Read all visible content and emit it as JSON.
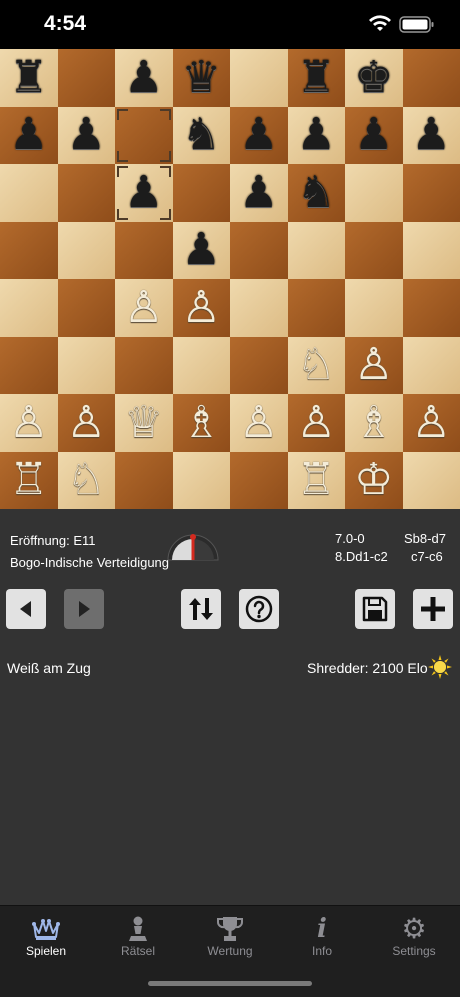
{
  "status_bar": {
    "time": "4:54"
  },
  "board": {
    "rows": [
      [
        "♜",
        "",
        "♟",
        "♛",
        "",
        "♜",
        "♚",
        ""
      ],
      [
        "♟",
        "♟",
        "",
        "♞",
        "♟",
        "♟",
        "♟",
        "♟"
      ],
      [
        "",
        "",
        "♟",
        "",
        "♟",
        "♞",
        "",
        ""
      ],
      [
        "",
        "",
        "",
        "♟",
        "",
        "",
        "",
        ""
      ],
      [
        "",
        "",
        "♙",
        "♙",
        "",
        "",
        "",
        ""
      ],
      [
        "",
        "",
        "",
        "",
        "",
        "♘",
        "♙",
        ""
      ],
      [
        "♙",
        "♙",
        "♕",
        "♗",
        "♙",
        "♙",
        "♗",
        "♙"
      ],
      [
        "♖",
        "♘",
        "",
        "",
        "",
        "♖",
        "♔",
        ""
      ]
    ],
    "colors": [
      [
        "b",
        "",
        "b",
        "b",
        "",
        "b",
        "b",
        ""
      ],
      [
        "b",
        "b",
        "",
        "b",
        "b",
        "b",
        "b",
        "b"
      ],
      [
        "",
        "",
        "b",
        "",
        "b",
        "b",
        "",
        ""
      ],
      [
        "",
        "",
        "",
        "b",
        "",
        "",
        "",
        ""
      ],
      [
        "",
        "",
        "w",
        "w",
        "",
        "",
        "",
        ""
      ],
      [
        "",
        "",
        "",
        "",
        "",
        "w",
        "w",
        ""
      ],
      [
        "w",
        "w",
        "w",
        "w",
        "w",
        "w",
        "w",
        "w"
      ],
      [
        "w",
        "w",
        "",
        "",
        "",
        "w",
        "w",
        ""
      ]
    ],
    "light_color": "#e6c998",
    "dark_color": "#a25b24"
  },
  "game_info": {
    "opening_label": "Eröffnung: E11",
    "opening_name": "Bogo-Indische Verteidigung",
    "moves": [
      {
        "col1": "7.0-0",
        "col2": "Sb8-d7"
      },
      {
        "col1": "8.Dd1-c2",
        "col2": "c7-c6"
      }
    ]
  },
  "toolbar": {
    "back_icon": "triangle-left-icon",
    "forward_icon": "triangle-right-icon",
    "flip_icon": "flip-arrows-icon",
    "hint_icon": "question-icon",
    "save_icon": "floppy-disk-icon",
    "new_icon": "plus-icon"
  },
  "status": {
    "turn": "Weiß am Zug",
    "engine": "Shredder: 2100 Elo"
  },
  "tabs": [
    {
      "label": "Spielen",
      "icon": "crown-icon",
      "active": true
    },
    {
      "label": "Rätsel",
      "icon": "pawn-icon",
      "active": false
    },
    {
      "label": "Wertung",
      "icon": "trophy-icon",
      "active": false
    },
    {
      "label": "Info",
      "icon": "info-icon",
      "active": false
    },
    {
      "label": "Settings",
      "icon": "gear-icon",
      "active": false
    }
  ]
}
